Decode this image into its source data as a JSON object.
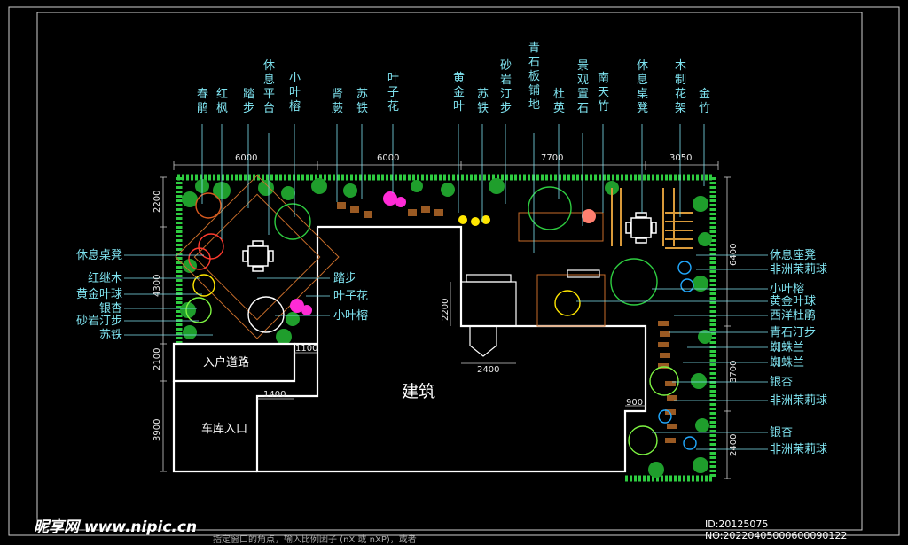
{
  "labels_top": [
    {
      "id": "chunjuan",
      "text": "春鹃"
    },
    {
      "id": "hongfeng",
      "text": "红枫"
    },
    {
      "id": "tabu",
      "text": "踏步"
    },
    {
      "id": "xiuxipingtai",
      "text": "休息平台"
    },
    {
      "id": "xiaoyerong",
      "text": "小叶榕"
    },
    {
      "id": "shenjue",
      "text": "肾蕨"
    },
    {
      "id": "sutie",
      "text": "苏铁"
    },
    {
      "id": "yezihua",
      "text": "叶子花"
    },
    {
      "id": "huangjinye",
      "text": "黄金叶"
    },
    {
      "id": "sutie2",
      "text": "苏铁"
    },
    {
      "id": "shayantingbu",
      "text": "砂岩汀步"
    },
    {
      "id": "qingshibanpudi",
      "text": "青石板铺地"
    },
    {
      "id": "duying",
      "text": "杜英"
    },
    {
      "id": "jingguanzhishi",
      "text": "景观置石"
    },
    {
      "id": "nantianzhu",
      "text": "南天竹"
    },
    {
      "id": "xiuxizhuodeng",
      "text": "休息桌凳"
    },
    {
      "id": "muzhihuajia",
      "text": "木制花架"
    },
    {
      "id": "jinzhu",
      "text": "金竹"
    }
  ],
  "labels_left": [
    {
      "id": "xiuxizhuodeng-l",
      "text": "休息桌凳"
    },
    {
      "id": "hongjimu",
      "text": "红继木"
    },
    {
      "id": "huangjinyeqiu-l",
      "text": "黄金叶球"
    },
    {
      "id": "yinxing-l",
      "text": "银杏"
    },
    {
      "id": "shayantingbu-l",
      "text": "砂岩汀步"
    },
    {
      "id": "sutie-l",
      "text": "苏铁"
    }
  ],
  "labels_inner": [
    {
      "id": "tabu-i",
      "text": "踏步"
    },
    {
      "id": "yezihua-i",
      "text": "叶子花"
    },
    {
      "id": "xiaoyerong-i",
      "text": "小叶榕"
    }
  ],
  "labels_right": [
    {
      "id": "xiuxizuodeng",
      "text": "休息座凳"
    },
    {
      "id": "feizhoumoliqiu1",
      "text": "非洲茉莉球"
    },
    {
      "id": "xiaoyerong-r",
      "text": "小叶榕"
    },
    {
      "id": "huangjinyeqiu-r",
      "text": "黄金叶球"
    },
    {
      "id": "xiyangdujuan",
      "text": "西洋杜鹃"
    },
    {
      "id": "qingshitingbu",
      "text": "青石汀步"
    },
    {
      "id": "zhizhulan1",
      "text": "蜘蛛兰"
    },
    {
      "id": "zhizhulan2",
      "text": "蜘蛛兰"
    },
    {
      "id": "yinxing-r1",
      "text": "银杏"
    },
    {
      "id": "feizhoumoliqiu2",
      "text": "非洲茉莉球"
    },
    {
      "id": "yinxing-r2",
      "text": "银杏"
    },
    {
      "id": "feizhoumoliqiu3",
      "text": "非洲茉莉球"
    }
  ],
  "dimensions": {
    "top": [
      "6000",
      "6000",
      "7700",
      "3050"
    ],
    "left": [
      "2200",
      "4300",
      "2100",
      "3900"
    ],
    "right": [
      "6400",
      "3700",
      "2400"
    ],
    "inner": {
      "d1100": "1100",
      "d1400": "1400",
      "d900": "900",
      "d2200": "2200",
      "d2400": "2400"
    }
  },
  "areas": {
    "building": "建筑",
    "entry_road": "入户道路",
    "garage": "车库入口"
  },
  "status_line": "指定窗口的角点，输入比例因子 (nX 或 nXP)，或者",
  "watermark": {
    "site": "昵享网 www.nipic.cn",
    "id": "ID:20125075 NO:20220405000600090122"
  },
  "colors": {
    "background": "#000000",
    "label": "#7fe3f0",
    "plant": "#2ecc40",
    "wall": "#ffffff",
    "flower_red": "#ff3b2f",
    "flower_magenta": "#ff2bd6",
    "yellow": "#ffe600",
    "cyan_ball": "#22aaff"
  }
}
